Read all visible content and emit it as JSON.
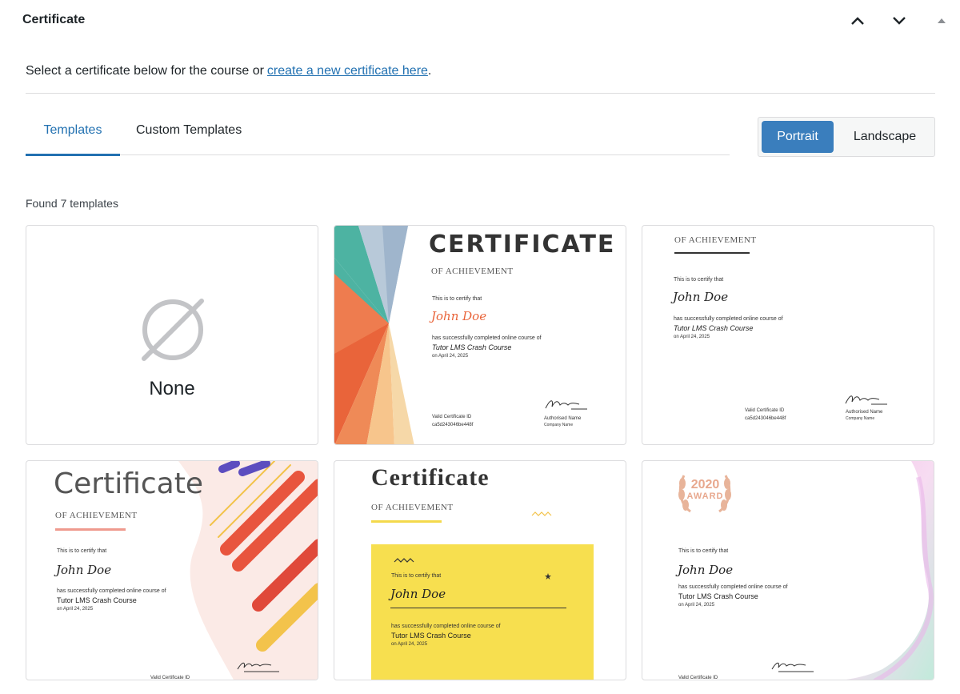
{
  "panel": {
    "title": "Certificate"
  },
  "intro": {
    "text": "Select a certificate below for the course or",
    "link": "create a new certificate here",
    "suffix": "."
  },
  "tabs": [
    {
      "label": "Templates",
      "active": true
    },
    {
      "label": "Custom Templates",
      "active": false
    }
  ],
  "orientation": {
    "portrait": "Portrait",
    "landscape": "Landscape",
    "selected": "Portrait"
  },
  "found_text": "Found 7 templates",
  "colors": {
    "accent": "#2271b1",
    "button_active": "#3a7ebd"
  },
  "templates": [
    {
      "label": "None",
      "icon": "none-icon"
    },
    {
      "heading": "CERTIFICATE",
      "subheading": "OF ACHIEVEMENT",
      "certify": "This is to certify that",
      "name": "John Doe",
      "completed": "has successfully completed online course of",
      "course": "Tutor LMS Crash Course",
      "date": "on April 24, 2025",
      "valid_label": "Valid Certificate ID",
      "valid_id": "ca5d243046be448f",
      "signer": "Authorised Name",
      "company": "Company Name"
    },
    {
      "subheading": "OF ACHIEVEMENT",
      "certify": "This is to certify that",
      "name": "John Doe",
      "completed": "has successfully completed online course of",
      "course": "Tutor LMS Crash Course",
      "date": "on April 24, 2025",
      "valid_label": "Valid Certificate ID",
      "valid_id": "ca5d243046be448f",
      "signer": "Authorised Name",
      "company": "Company Name"
    },
    {
      "heading": "Certificate",
      "subheading": "OF ACHIEVEMENT",
      "certify": "This is to certify that",
      "name": "John Doe",
      "completed": "has successfully completed online course of",
      "course": "Tutor LMS Crash Course",
      "date": "on April 24, 2025",
      "valid_label": "Valid Certificate ID"
    },
    {
      "heading": "Certificate",
      "subheading": "OF ACHIEVEMENT",
      "certify": "This is to certify that",
      "name": "John Doe",
      "completed": "has successfully completed online course of",
      "course": "Tutor LMS Crash Course",
      "date": "on April 24, 2025"
    },
    {
      "badge_year": "2020",
      "badge_text": "AWARD",
      "certify": "This is to certify that",
      "name": "John Doe",
      "completed": "has successfully completed online course of",
      "course": "Tutor LMS Crash Course",
      "date": "on April 24, 2025",
      "valid_label": "Valid Certificate ID"
    }
  ]
}
